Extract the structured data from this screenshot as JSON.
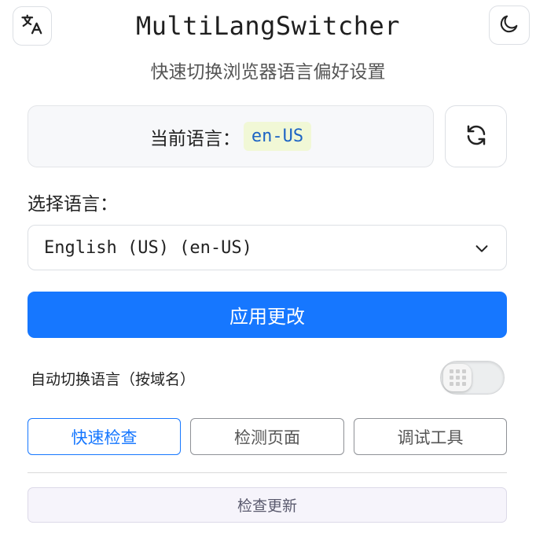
{
  "header": {
    "title": "MultiLangSwitcher",
    "subtitle": "快速切换浏览器语言偏好设置",
    "translate_icon": "translate-icon",
    "theme_icon": "moon-icon"
  },
  "current": {
    "label": "当前语言：",
    "code": "en-US",
    "refresh_icon": "refresh-icon"
  },
  "selector": {
    "label": "选择语言：",
    "selected": "English (US) (en-US)"
  },
  "apply_label": "应用更改",
  "auto_switch": {
    "label": "自动切换语言（按域名）",
    "enabled": false
  },
  "tools": {
    "quick": "快速检查",
    "detect": "检测页面",
    "debug": "调试工具"
  },
  "update_label": "检查更新",
  "colors": {
    "accent": "#1677ff",
    "code_bg": "#f1f8d6",
    "code_text": "#1d64c4"
  }
}
